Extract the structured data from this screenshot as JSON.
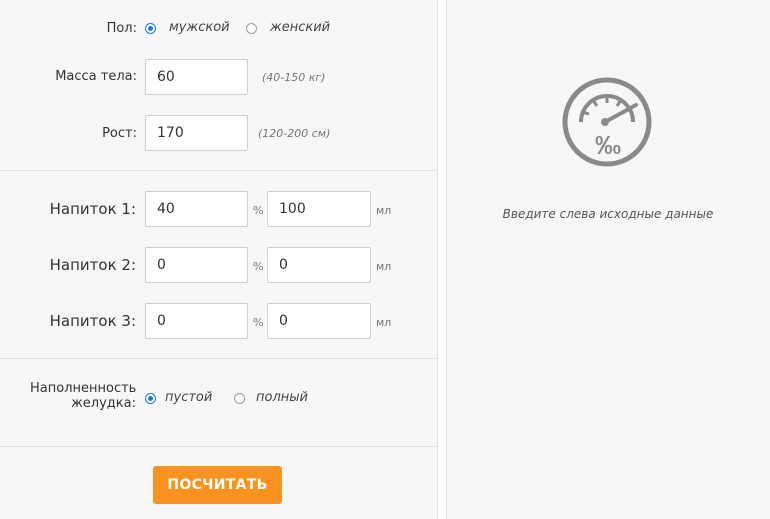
{
  "gender": {
    "label": "Пол:",
    "options": [
      "мужской",
      "женский"
    ],
    "selected": "мужской"
  },
  "weight": {
    "label": "Масса тела:",
    "value": "60",
    "hint": "(40-150 кг)"
  },
  "height": {
    "label": "Рост:",
    "value": "170",
    "hint": "(120-200 см)"
  },
  "drinks": [
    {
      "label": "Напиток 1:",
      "percent": "40",
      "volume": "100"
    },
    {
      "label": "Напиток 2:",
      "percent": "0",
      "volume": "0"
    },
    {
      "label": "Напиток 3:",
      "percent": "0",
      "volume": "0"
    }
  ],
  "units": {
    "percent": "%",
    "ml": "мл"
  },
  "stomach": {
    "label_line1": "Наполненность",
    "label_line2": "желудка:",
    "options": [
      "пустой",
      "полный"
    ],
    "selected": "пустой"
  },
  "calculate_button": "ПОСЧИТАТЬ",
  "result": {
    "gauge_text": "‰",
    "placeholder": "Введите слева исходные данные"
  },
  "colors": {
    "accent": "#f7931e",
    "radio": "#1a73e8",
    "gauge": "#8a8a8a"
  }
}
